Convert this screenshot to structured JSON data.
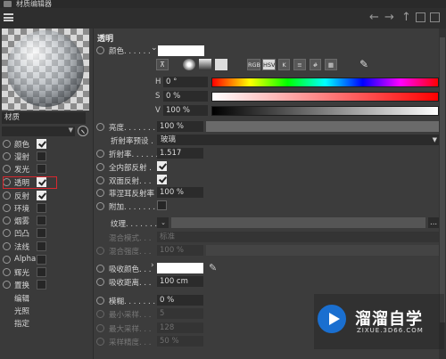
{
  "window": {
    "title": "材质编辑器"
  },
  "toolbar": {
    "back": "←",
    "forward": "→",
    "up": "↑",
    "lock": ""
  },
  "sidebar": {
    "material_name": "材质",
    "channels": [
      {
        "label": "颜色",
        "checked": true
      },
      {
        "label": "漫射",
        "checked": false
      },
      {
        "label": "发光",
        "checked": false
      },
      {
        "label": "透明",
        "checked": true
      },
      {
        "label": "反射",
        "checked": true
      },
      {
        "label": "环境",
        "checked": false
      },
      {
        "label": "烟雾",
        "checked": false
      },
      {
        "label": "凹凸",
        "checked": false
      },
      {
        "label": "法线",
        "checked": false
      },
      {
        "label": "Alpha",
        "checked": false
      },
      {
        "label": "辉光",
        "checked": false
      },
      {
        "label": "置换",
        "checked": false
      }
    ],
    "extra": [
      "编辑",
      "光照",
      "指定"
    ]
  },
  "panel": {
    "heading": "透明",
    "color_label": "颜色. . . . . .",
    "mode_tabs": [
      "RGB",
      "HSV",
      "K"
    ],
    "h_label": "H",
    "h_value": "0 °",
    "s_label": "S",
    "s_value": "0 %",
    "v_label": "V",
    "v_value": "100 %",
    "brightness_label": "亮度. . . . . . .",
    "brightness_value": "100 %",
    "brightness_fill": 1.0,
    "preset_label": "折射率预设 .",
    "preset_value": "玻璃",
    "ior_label": "折射率. . . . . .",
    "ior_value": "1.517",
    "total_internal_label": "全内部反射 .",
    "double_sided_label": "双面反射. . .",
    "fresnel_label": "菲涅耳反射率",
    "fresnel_value": "100 %",
    "additive_label": "附加. . . . . . .",
    "texture_label": "纹理. . . . . . .",
    "texture_btn": "...",
    "blend_mode_label": "混合模式. . .",
    "blend_mode_value": "标准",
    "blend_strength_label": "混合强度. . .",
    "blend_strength_value": "100 %",
    "absorb_color_label": "吸收颜色. . .",
    "absorb_dist_label": "吸收距离. . .",
    "absorb_dist_value": "100 cm",
    "blur_label": "模糊. . . . . . .",
    "blur_value": "0 %",
    "min_samples_label": "最小采样. . .",
    "min_samples_value": "5",
    "max_samples_label": "最大采样. . .",
    "max_samples_value": "128",
    "accuracy_label": "采样精度. . .",
    "accuracy_value": "50 %"
  },
  "watermark": {
    "name": "溜溜自学",
    "url": "ZIXUE.3D66.COM"
  }
}
